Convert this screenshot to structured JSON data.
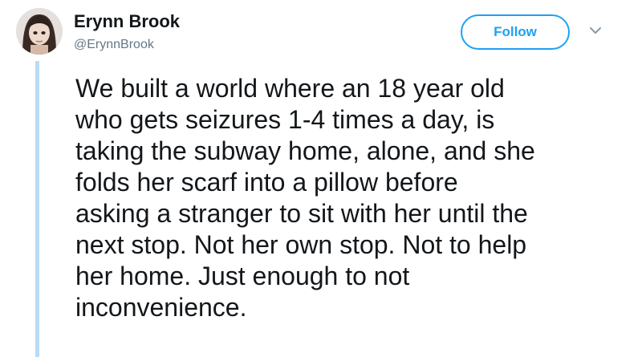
{
  "header": {
    "display_name": "Erynn Brook",
    "handle": "@ErynnBrook",
    "follow_label": "Follow"
  },
  "icons": {
    "avatar": "user-avatar",
    "menu": "chevron-down-icon"
  },
  "colors": {
    "accent": "#1da1f2",
    "text": "#14171a",
    "secondary_text": "#657786",
    "thread_line": "#b9dcf4"
  },
  "tweet": {
    "lines": [
      "We built a world where an 18 year old",
      "who gets seizures 1-4 times a day, is",
      "taking the subway home, alone, and she",
      "folds her scarf into a pillow before",
      "asking a stranger to sit with her until the",
      "next stop. Not her own stop. Not to help",
      "her home. Just enough to not",
      "inconvenience."
    ]
  }
}
